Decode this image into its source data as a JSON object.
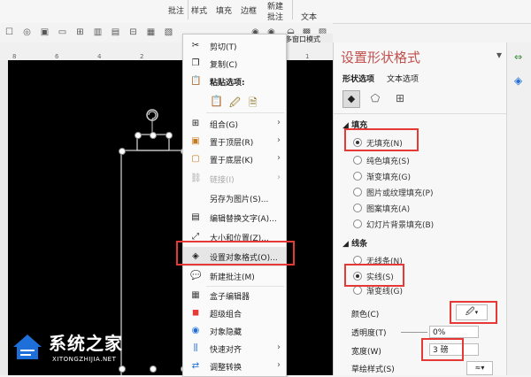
{
  "ribbon": {
    "groups": [
      "批注",
      "样式",
      "填充",
      "边框",
      "新建",
      "批注",
      "文本"
    ],
    "multi_window": "多窗口模式"
  },
  "ruler": {
    "ticks": [
      "8",
      "6",
      "4",
      "2",
      "1"
    ]
  },
  "context_menu": {
    "items": [
      {
        "label": "剪切(T)",
        "icon": "scissors-icon"
      },
      {
        "label": "复制(C)",
        "icon": "copy-icon"
      },
      {
        "label": "粘贴选项:",
        "icon": "paste-icon",
        "bold": true
      },
      {
        "label": "组合(G)",
        "icon": "group-icon",
        "submenu": true
      },
      {
        "label": "置于顶层(R)",
        "icon": "bring-front-icon",
        "submenu": true
      },
      {
        "label": "置于底层(K)",
        "icon": "send-back-icon",
        "submenu": true
      },
      {
        "label": "链接(I)",
        "icon": "link-icon",
        "submenu": true,
        "disabled": true
      },
      {
        "label": "另存为图片(S)...",
        "icon": ""
      },
      {
        "label": "编辑替换文字(A)...",
        "icon": "alt-text-icon"
      },
      {
        "label": "大小和位置(Z)...",
        "icon": "size-icon"
      },
      {
        "label": "设置对象格式(O)...",
        "icon": "format-icon",
        "highlight": true
      },
      {
        "label": "新建批注(M)",
        "icon": "comment-icon"
      },
      {
        "label": "盒子编辑器",
        "icon": "box-editor-icon"
      },
      {
        "label": "超级组合",
        "icon": "super-group-icon"
      },
      {
        "label": "对象隐藏",
        "icon": "hide-icon"
      },
      {
        "label": "快速对齐",
        "icon": "align-icon",
        "submenu": true
      },
      {
        "label": "调整转换",
        "icon": "convert-icon",
        "submenu": true
      }
    ]
  },
  "panel": {
    "title": "设置形状格式",
    "tabs": [
      "形状选项",
      "文本选项"
    ],
    "fill_header": "填充",
    "fill_options": [
      {
        "label": "无填充(N)",
        "selected": true
      },
      {
        "label": "纯色填充(S)",
        "selected": false
      },
      {
        "label": "渐变填充(G)",
        "selected": false
      },
      {
        "label": "图片或纹理填充(P)",
        "selected": false
      },
      {
        "label": "图案填充(A)",
        "selected": false
      },
      {
        "label": "幻灯片背景填充(B)",
        "selected": false
      }
    ],
    "line_header": "线条",
    "line_options": [
      {
        "label": "无线条(N)",
        "selected": false
      },
      {
        "label": "实线(S)",
        "selected": true
      },
      {
        "label": "渐变线(G)",
        "selected": false
      }
    ],
    "color_label": "颜色(C)",
    "transparency_label": "透明度(T)",
    "transparency_value": "0%",
    "width_label": "宽度(W)",
    "width_value": "3 磅",
    "sketch_label": "草绘样式(S)"
  },
  "watermark": {
    "main": "系统之家",
    "sub": "XITONGZHIJIA.NET"
  },
  "colors": {
    "accent_red": "#e53935",
    "panel_title": "#c0504d",
    "logo_blue": "#1e6fd9"
  }
}
